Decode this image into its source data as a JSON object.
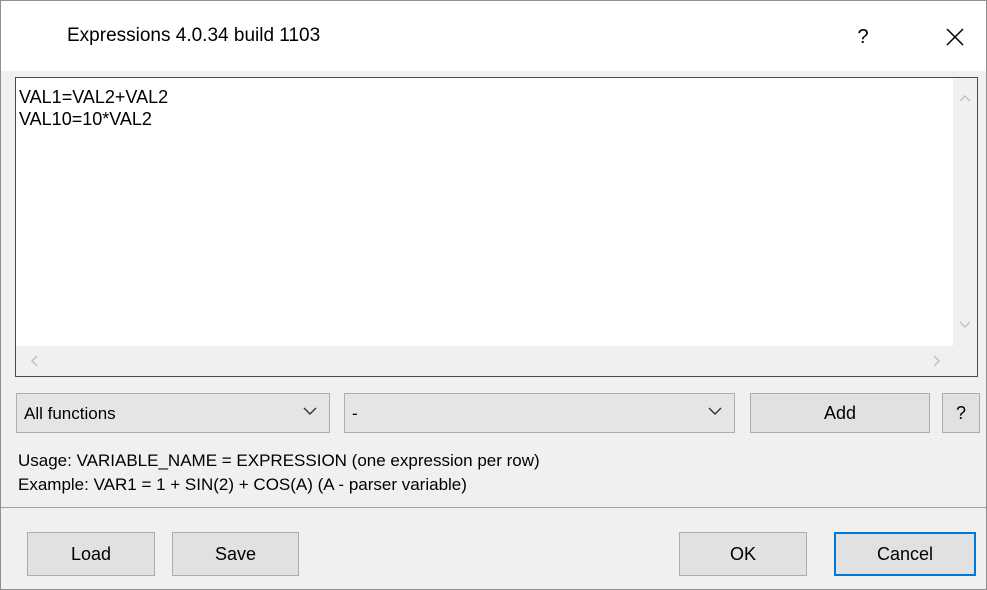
{
  "window": {
    "title": "Expressions 4.0.34 build 1103",
    "help_label": "?"
  },
  "editor": {
    "lines": [
      "VAL1=VAL2+VAL2",
      "VAL10=10*VAL2"
    ]
  },
  "controls": {
    "functions_select": {
      "value": "All functions"
    },
    "variable_select": {
      "value": "-"
    },
    "add_label": "Add",
    "help_label": "?"
  },
  "info": {
    "usage": "Usage: VARIABLE_NAME = EXPRESSION (one expression per row)",
    "example": "Example: VAR1 = 1 + SIN(2) + COS(A) (A - parser variable)"
  },
  "footer": {
    "load_label": "Load",
    "save_label": "Save",
    "ok_label": "OK",
    "cancel_label": "Cancel"
  },
  "colors": {
    "dialog_bg": "#f0f0f0",
    "default_button_border": "#0078d7"
  }
}
